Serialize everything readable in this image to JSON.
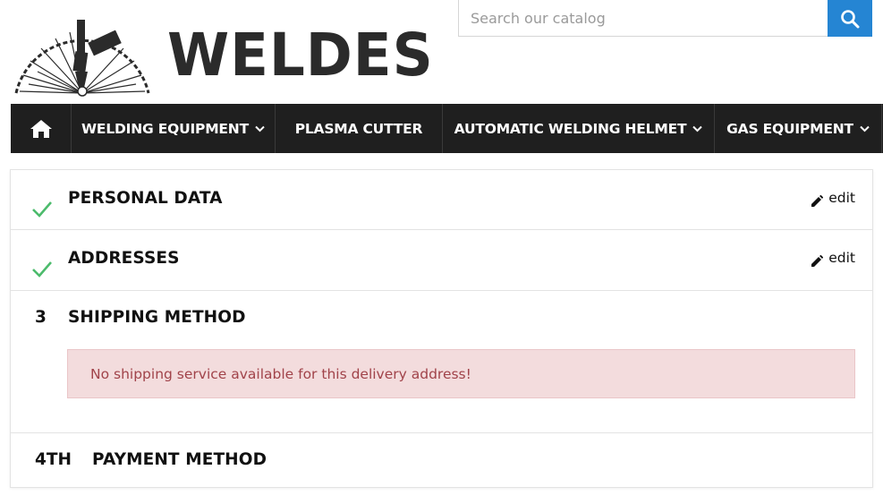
{
  "brand": {
    "name": "WELDES",
    "logo_icon": "welding-torch-logo",
    "text_color": "#2b2b2b"
  },
  "search": {
    "placeholder": "Search our catalog",
    "button_icon": "search-icon",
    "button_color": "#2585d3"
  },
  "nav": {
    "home_icon": "home-icon",
    "items": [
      {
        "label": "WELDING EQUIPMENT",
        "has_dropdown": true
      },
      {
        "label": "PLASMA CUTTER",
        "has_dropdown": false
      },
      {
        "label": "AUTOMATIC WELDING HELMET",
        "has_dropdown": true
      },
      {
        "label": "GAS EQUIPMENT",
        "has_dropdown": true
      }
    ],
    "background": "#1f1f1f"
  },
  "checkout": {
    "steps": [
      {
        "title": "PERSONAL DATA",
        "status": "complete",
        "status_icon": "check-icon",
        "edit_label": "edit"
      },
      {
        "title": "ADDRESSES",
        "status": "complete",
        "status_icon": "check-icon",
        "edit_label": "edit"
      },
      {
        "number": "3",
        "title": "SHIPPING METHOD",
        "status": "current",
        "alert": "No shipping service available for this delivery address!"
      },
      {
        "number": "4TH",
        "title": "PAYMENT METHOD",
        "status": "pending"
      }
    ],
    "check_color": "#4cbb6c",
    "alert_bg": "#f3dcdd",
    "alert_text_color": "#a1434a"
  }
}
